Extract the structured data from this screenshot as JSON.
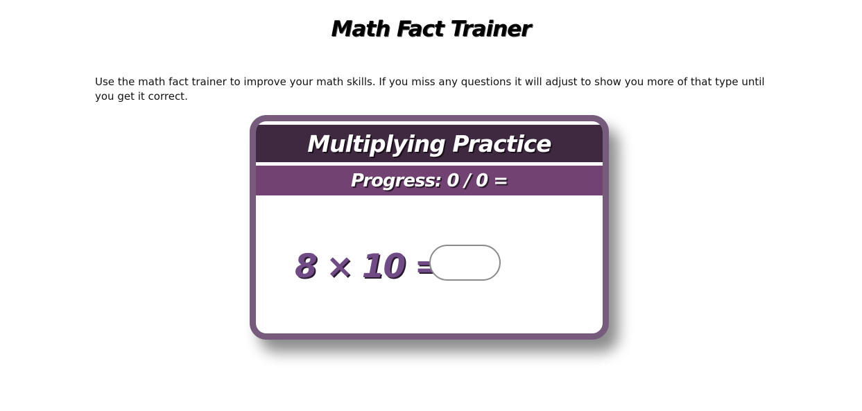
{
  "page": {
    "title": "Math Fact Trainer",
    "intro": "Use the math fact trainer to improve your math skills. If you miss any questions it will adjust to show you more of that type until you get it correct."
  },
  "trainer": {
    "title": "Multiplying Practice",
    "progress": "Progress: 0 / 0 =",
    "question": "8 × 10 =",
    "answer_value": "",
    "colors": {
      "frame": "#765b7d",
      "title_band": "#3f2940",
      "progress_band": "#714272",
      "question_text": "#714b86"
    }
  }
}
